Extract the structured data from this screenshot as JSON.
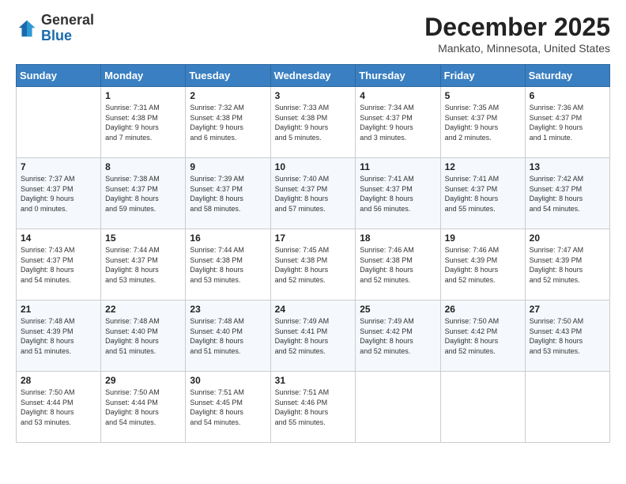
{
  "header": {
    "logo_general": "General",
    "logo_blue": "Blue",
    "title": "December 2025",
    "subtitle": "Mankato, Minnesota, United States"
  },
  "calendar": {
    "days_of_week": [
      "Sunday",
      "Monday",
      "Tuesday",
      "Wednesday",
      "Thursday",
      "Friday",
      "Saturday"
    ],
    "weeks": [
      [
        {
          "day": "",
          "text": ""
        },
        {
          "day": "1",
          "text": "Sunrise: 7:31 AM\nSunset: 4:38 PM\nDaylight: 9 hours\nand 7 minutes."
        },
        {
          "day": "2",
          "text": "Sunrise: 7:32 AM\nSunset: 4:38 PM\nDaylight: 9 hours\nand 6 minutes."
        },
        {
          "day": "3",
          "text": "Sunrise: 7:33 AM\nSunset: 4:38 PM\nDaylight: 9 hours\nand 5 minutes."
        },
        {
          "day": "4",
          "text": "Sunrise: 7:34 AM\nSunset: 4:37 PM\nDaylight: 9 hours\nand 3 minutes."
        },
        {
          "day": "5",
          "text": "Sunrise: 7:35 AM\nSunset: 4:37 PM\nDaylight: 9 hours\nand 2 minutes."
        },
        {
          "day": "6",
          "text": "Sunrise: 7:36 AM\nSunset: 4:37 PM\nDaylight: 9 hours\nand 1 minute."
        }
      ],
      [
        {
          "day": "7",
          "text": "Sunrise: 7:37 AM\nSunset: 4:37 PM\nDaylight: 9 hours\nand 0 minutes."
        },
        {
          "day": "8",
          "text": "Sunrise: 7:38 AM\nSunset: 4:37 PM\nDaylight: 8 hours\nand 59 minutes."
        },
        {
          "day": "9",
          "text": "Sunrise: 7:39 AM\nSunset: 4:37 PM\nDaylight: 8 hours\nand 58 minutes."
        },
        {
          "day": "10",
          "text": "Sunrise: 7:40 AM\nSunset: 4:37 PM\nDaylight: 8 hours\nand 57 minutes."
        },
        {
          "day": "11",
          "text": "Sunrise: 7:41 AM\nSunset: 4:37 PM\nDaylight: 8 hours\nand 56 minutes."
        },
        {
          "day": "12",
          "text": "Sunrise: 7:41 AM\nSunset: 4:37 PM\nDaylight: 8 hours\nand 55 minutes."
        },
        {
          "day": "13",
          "text": "Sunrise: 7:42 AM\nSunset: 4:37 PM\nDaylight: 8 hours\nand 54 minutes."
        }
      ],
      [
        {
          "day": "14",
          "text": "Sunrise: 7:43 AM\nSunset: 4:37 PM\nDaylight: 8 hours\nand 54 minutes."
        },
        {
          "day": "15",
          "text": "Sunrise: 7:44 AM\nSunset: 4:37 PM\nDaylight: 8 hours\nand 53 minutes."
        },
        {
          "day": "16",
          "text": "Sunrise: 7:44 AM\nSunset: 4:38 PM\nDaylight: 8 hours\nand 53 minutes."
        },
        {
          "day": "17",
          "text": "Sunrise: 7:45 AM\nSunset: 4:38 PM\nDaylight: 8 hours\nand 52 minutes."
        },
        {
          "day": "18",
          "text": "Sunrise: 7:46 AM\nSunset: 4:38 PM\nDaylight: 8 hours\nand 52 minutes."
        },
        {
          "day": "19",
          "text": "Sunrise: 7:46 AM\nSunset: 4:39 PM\nDaylight: 8 hours\nand 52 minutes."
        },
        {
          "day": "20",
          "text": "Sunrise: 7:47 AM\nSunset: 4:39 PM\nDaylight: 8 hours\nand 52 minutes."
        }
      ],
      [
        {
          "day": "21",
          "text": "Sunrise: 7:48 AM\nSunset: 4:39 PM\nDaylight: 8 hours\nand 51 minutes."
        },
        {
          "day": "22",
          "text": "Sunrise: 7:48 AM\nSunset: 4:40 PM\nDaylight: 8 hours\nand 51 minutes."
        },
        {
          "day": "23",
          "text": "Sunrise: 7:48 AM\nSunset: 4:40 PM\nDaylight: 8 hours\nand 51 minutes."
        },
        {
          "day": "24",
          "text": "Sunrise: 7:49 AM\nSunset: 4:41 PM\nDaylight: 8 hours\nand 52 minutes."
        },
        {
          "day": "25",
          "text": "Sunrise: 7:49 AM\nSunset: 4:42 PM\nDaylight: 8 hours\nand 52 minutes."
        },
        {
          "day": "26",
          "text": "Sunrise: 7:50 AM\nSunset: 4:42 PM\nDaylight: 8 hours\nand 52 minutes."
        },
        {
          "day": "27",
          "text": "Sunrise: 7:50 AM\nSunset: 4:43 PM\nDaylight: 8 hours\nand 53 minutes."
        }
      ],
      [
        {
          "day": "28",
          "text": "Sunrise: 7:50 AM\nSunset: 4:44 PM\nDaylight: 8 hours\nand 53 minutes."
        },
        {
          "day": "29",
          "text": "Sunrise: 7:50 AM\nSunset: 4:44 PM\nDaylight: 8 hours\nand 54 minutes."
        },
        {
          "day": "30",
          "text": "Sunrise: 7:51 AM\nSunset: 4:45 PM\nDaylight: 8 hours\nand 54 minutes."
        },
        {
          "day": "31",
          "text": "Sunrise: 7:51 AM\nSunset: 4:46 PM\nDaylight: 8 hours\nand 55 minutes."
        },
        {
          "day": "",
          "text": ""
        },
        {
          "day": "",
          "text": ""
        },
        {
          "day": "",
          "text": ""
        }
      ]
    ]
  }
}
